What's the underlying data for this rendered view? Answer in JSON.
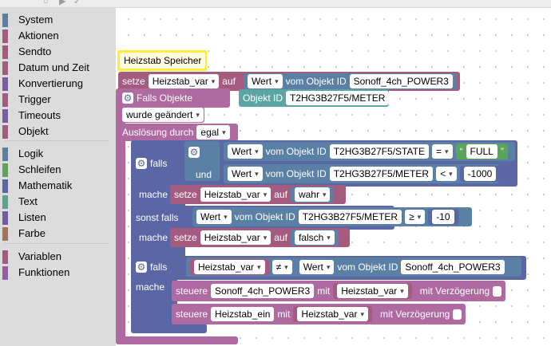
{
  "toolbox": {
    "categories": [
      {
        "label": "System",
        "color": "#5b80a5"
      },
      {
        "label": "Aktionen",
        "color": "#a55b80"
      },
      {
        "label": "Sendto",
        "color": "#a55b80"
      },
      {
        "label": "Datum und Zeit",
        "color": "#a55b80"
      },
      {
        "label": "Konvertierung",
        "color": "#7e5ba5"
      },
      {
        "label": "Trigger",
        "color": "#a55b80"
      },
      {
        "label": "Timeouts",
        "color": "#7e5ba5"
      },
      {
        "label": "Objekt",
        "color": "#a55b80"
      },
      {
        "label": "Logik",
        "color": "#5b80a5"
      },
      {
        "label": "Schleifen",
        "color": "#5ba55b"
      },
      {
        "label": "Mathematik",
        "color": "#5b67a5"
      },
      {
        "label": "Text",
        "color": "#5ba58c"
      },
      {
        "label": "Listen",
        "color": "#745ba5"
      },
      {
        "label": "Farbe",
        "color": "#a5745b"
      },
      {
        "label": "Variablen",
        "color": "#a55b80"
      },
      {
        "label": "Funktionen",
        "color": "#995ba5"
      }
    ]
  },
  "workspace": {
    "comment": "Heizstab Speicher",
    "set_block": {
      "setze": "setze",
      "var": "Heizstab_var",
      "auf": "auf",
      "prop": "Wert",
      "from": "vom Objekt ID",
      "oid": "Sonoff_4ch_POWER3"
    },
    "trigger": {
      "title": "Falls Objekte",
      "oid_label": "Objekt ID",
      "oid": "T2HG3B27F5/METER",
      "condition": "wurde geändert",
      "ack_label": "Auslösung durch",
      "ack": "egal"
    },
    "if1": {
      "falls": "falls",
      "und": "und",
      "mache": "mache",
      "sonst_falls": "sonst falls",
      "c1": {
        "prop": "Wert",
        "from": "vom Objekt ID",
        "oid": "T2HG3B27F5/STATE",
        "op": "=",
        "quote_open": "“",
        "value": "FULL",
        "quote_close": "”"
      },
      "c2": {
        "prop": "Wert",
        "from": "vom Objekt ID",
        "oid": "T2HG3B27F5/METER",
        "op": "<",
        "value": "-1000"
      },
      "a1": {
        "setze": "setze",
        "var": "Heizstab_var",
        "auf": "auf",
        "value": "wahr"
      },
      "c3": {
        "prop": "Wert",
        "from": "vom Objekt ID",
        "oid": "T2HG3B27F5/METER",
        "op": "≥",
        "value": "-10"
      },
      "a2": {
        "setze": "setze",
        "var": "Heizstab_var",
        "auf": "auf",
        "value": "falsch"
      }
    },
    "if2": {
      "falls": "falls",
      "mache": "mache",
      "var": "Heizstab_var",
      "op": "≠",
      "prop": "Wert",
      "from": "vom Objekt ID",
      "oid": "Sonoff_4ch_POWER3",
      "s1": {
        "label": "steuere",
        "oid": "Sonoff_4ch_POWER3",
        "mit": "mit",
        "var": "Heizstab_var",
        "delay": "mit Verzögerung"
      },
      "s2": {
        "label": "steuere",
        "oid": "Heizstab_ein",
        "mit": "mit",
        "var": "Heizstab_var",
        "delay": "mit Verzögerung"
      }
    }
  }
}
